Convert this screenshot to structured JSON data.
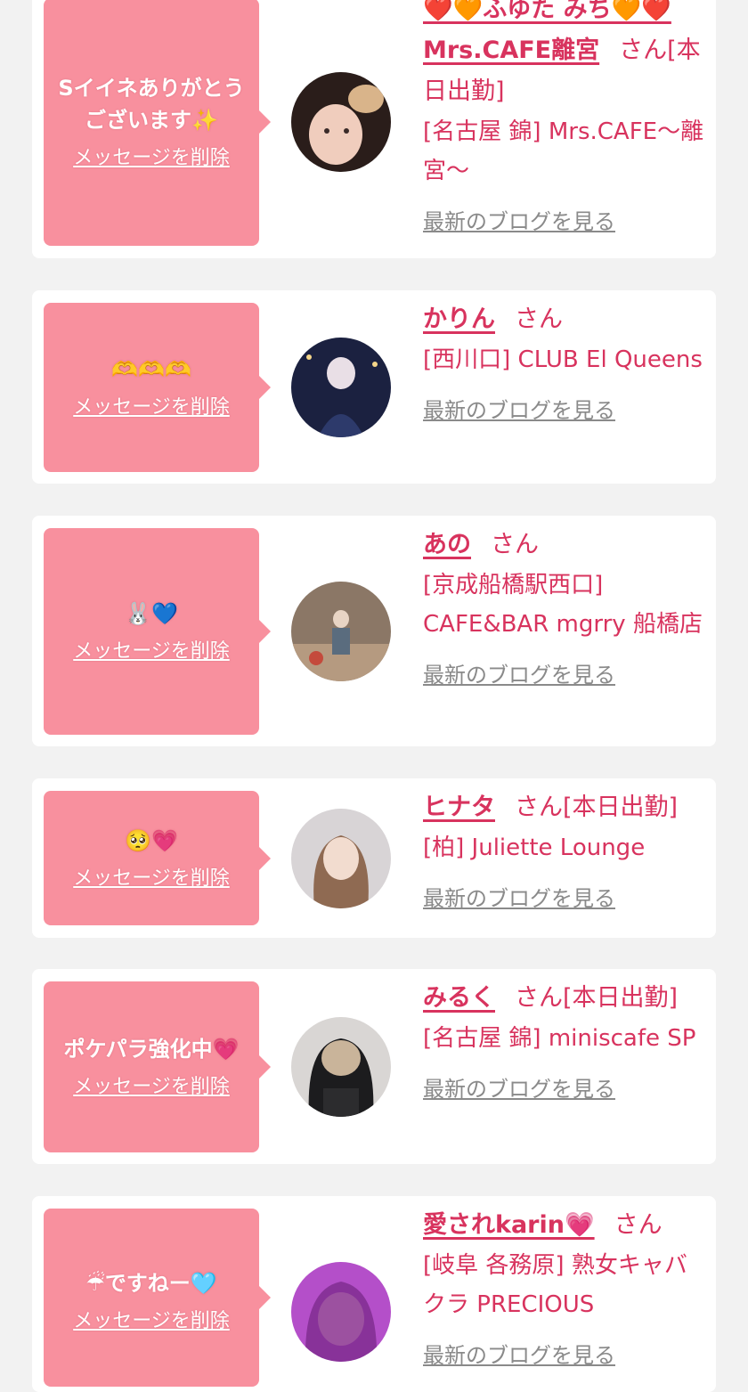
{
  "delete_label": "メッセージを削除",
  "san_label": "さん",
  "blog_label": "最新のブログを見る",
  "colors": {
    "accent": "#d8335e",
    "bubble": "#f8909e",
    "background": "#f2f2f2"
  },
  "items": [
    {
      "message": "Sイイネありがとうございます✨",
      "name": "❤️🧡ふゆた みち🧡❤️Mrs.CAFE離宮",
      "status": "[本日出勤]",
      "shop": "[名古屋 錦] Mrs.CAFE〜離宮〜"
    },
    {
      "message": "🫶🫶🫶",
      "name": "かりん",
      "status": "",
      "shop": "[西川口] CLUB El Queens"
    },
    {
      "message": "🐰💙",
      "name": "あの",
      "status": "",
      "shop": "[京成船橋駅西口] CAFE&BAR mgrry 船橋店"
    },
    {
      "message": "🥺💗",
      "name": "ヒナタ",
      "status": "[本日出勤]",
      "shop": "[柏] Juliette Lounge"
    },
    {
      "message": "ポケパラ強化中💗",
      "name": "みるく",
      "status": "[本日出勤]",
      "shop": "[名古屋 錦] miniscafe SP"
    },
    {
      "message": "☔ですねー🩵",
      "name": "愛されkarin💗",
      "status": "",
      "shop": "[岐阜 各務原] 熟女キャバクラ PRECIOUS"
    }
  ]
}
